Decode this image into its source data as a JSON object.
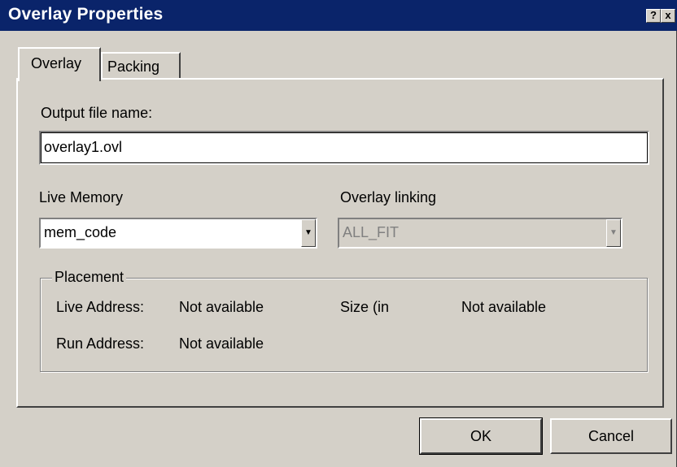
{
  "window": {
    "title": "Overlay Properties"
  },
  "titlebar_buttons": {
    "help": "?",
    "close": "x"
  },
  "tabs": [
    {
      "label": "Overlay",
      "active": true
    },
    {
      "label": "Packing",
      "active": false
    }
  ],
  "output_file": {
    "label": "Output file name:",
    "value": "overlay1.ovl"
  },
  "live_memory": {
    "label": "Live Memory",
    "value": "mem_code"
  },
  "overlay_linking": {
    "label": "Overlay linking",
    "value": "ALL_FIT",
    "enabled": false
  },
  "placement": {
    "legend": "Placement",
    "live_address_label": "Live Address:",
    "live_address_value": "Not available",
    "size_label": "Size (in",
    "size_value": "Not available",
    "run_address_label": "Run Address:",
    "run_address_value": "Not available"
  },
  "buttons": {
    "ok": "OK",
    "cancel": "Cancel"
  }
}
